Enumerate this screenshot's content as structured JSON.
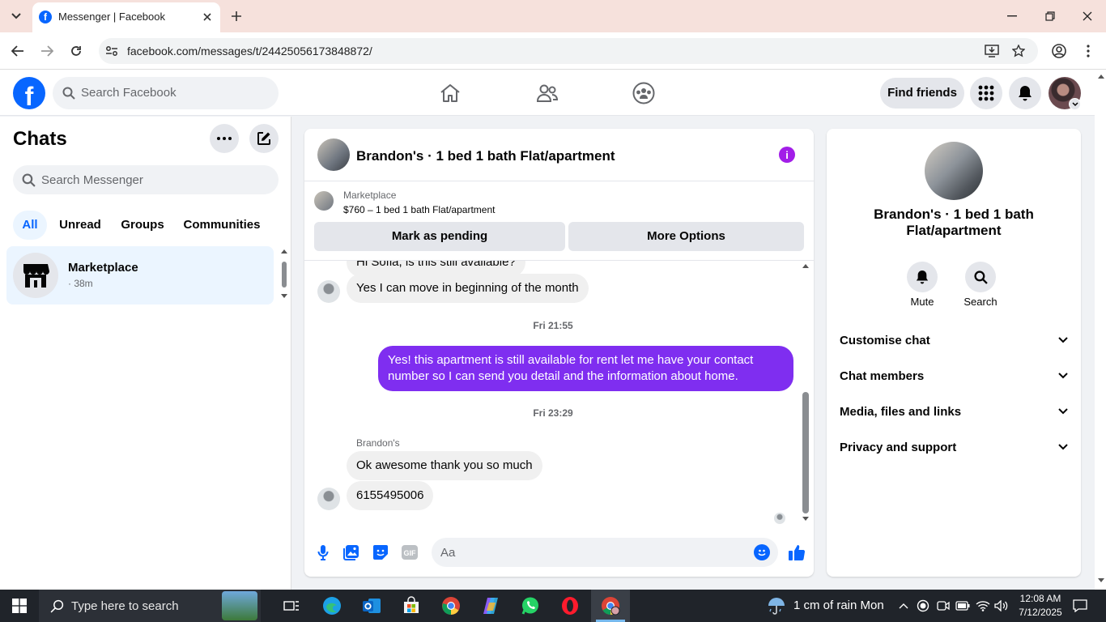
{
  "browser": {
    "tab_title": "Messenger | Facebook",
    "url": "facebook.com/messages/t/24425056173848872/"
  },
  "header": {
    "search_placeholder": "Search Facebook",
    "find_friends": "Find friends"
  },
  "sidebar": {
    "title": "Chats",
    "search_placeholder": "Search Messenger",
    "filters": [
      "All",
      "Unread",
      "Groups",
      "Communities"
    ],
    "active_filter": "All",
    "chats": [
      {
        "name": "Marketplace",
        "meta": "· 38m"
      }
    ]
  },
  "conversation": {
    "title": "Brandon's · 1 bed 1 bath Flat/apartment",
    "listing": {
      "label": "Marketplace",
      "detail": "$760 – 1 bed 1 bath Flat/apartment",
      "pending_button": "Mark as pending",
      "options_button": "More Options"
    },
    "partial_message": "Hi Sofia, is this still available?",
    "messages": [
      {
        "from": "other",
        "text": "Yes I can move in beginning of the month"
      },
      {
        "type": "timestamp",
        "text": "Fri 21:55"
      },
      {
        "from": "me",
        "text": "Yes! this apartment is still available for rent let me have your contact number so I can send you detail and the information about home."
      },
      {
        "type": "timestamp",
        "text": "Fri 23:29"
      },
      {
        "type": "sender",
        "text": "Brandon's"
      },
      {
        "from": "other",
        "text": "Ok awesome thank you so much"
      },
      {
        "from": "other",
        "text": "6155495006"
      }
    ],
    "composer_placeholder": "Aa"
  },
  "details": {
    "name": "Brandon's · 1 bed 1 bath Flat/apartment",
    "actions": [
      "Mute",
      "Search"
    ],
    "sections": [
      "Customise chat",
      "Chat members",
      "Media, files and links",
      "Privacy and support"
    ]
  },
  "taskbar": {
    "search_placeholder": "Type here to search",
    "weather": "1 cm of rain Mon",
    "time": "12:08 AM",
    "date": "7/12/2025"
  },
  "colors": {
    "fb_blue": "#0866ff",
    "messenger_purple": "#7f2ef0",
    "taskbar": "#20242a"
  }
}
